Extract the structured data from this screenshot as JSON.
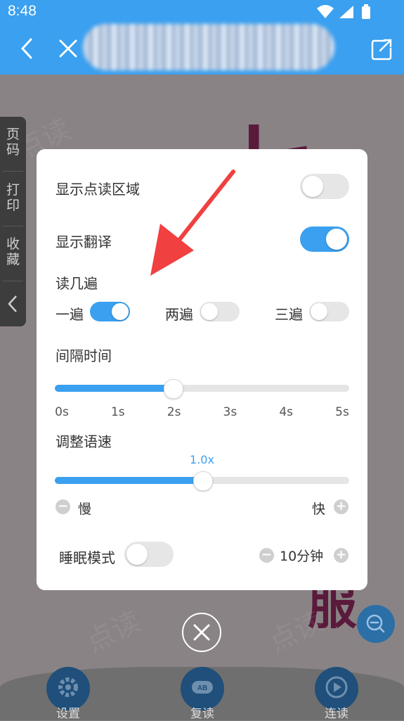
{
  "status": {
    "time": "8:48"
  },
  "side_panel": {
    "items": [
      "页\n码",
      "打\n印",
      "收\n藏"
    ]
  },
  "dialog": {
    "show_area_label": "显示点读区域",
    "show_area_on": false,
    "show_translation_label": "显示翻译",
    "show_translation_on": true,
    "repeat_title": "读几遍",
    "repeat_options": [
      {
        "label": "一遍",
        "on": true
      },
      {
        "label": "两遍",
        "on": false
      },
      {
        "label": "三遍",
        "on": false
      }
    ],
    "interval_title": "间隔时间",
    "interval_ticks": [
      "0s",
      "1s",
      "2s",
      "3s",
      "4s",
      "5s"
    ],
    "interval_value": 2,
    "speed_title": "调整语速",
    "speed_value_label": "1.0x",
    "speed_fraction": 0.5,
    "slow_label": "慢",
    "fast_label": "快",
    "sleep_label": "睡眠模式",
    "sleep_on": false,
    "sleep_time": "10分钟"
  },
  "bottom": {
    "buttons": [
      "设置",
      "复读",
      "连读"
    ]
  },
  "icons": {
    "back": "chevron-left-icon",
    "close": "close-icon",
    "share": "share-icon",
    "zoom": "zoom-out-icon",
    "minus": "minus-icon",
    "plus": "plus-icon"
  },
  "colors": {
    "accent": "#3aa0ef",
    "arrow": "#f04040"
  }
}
